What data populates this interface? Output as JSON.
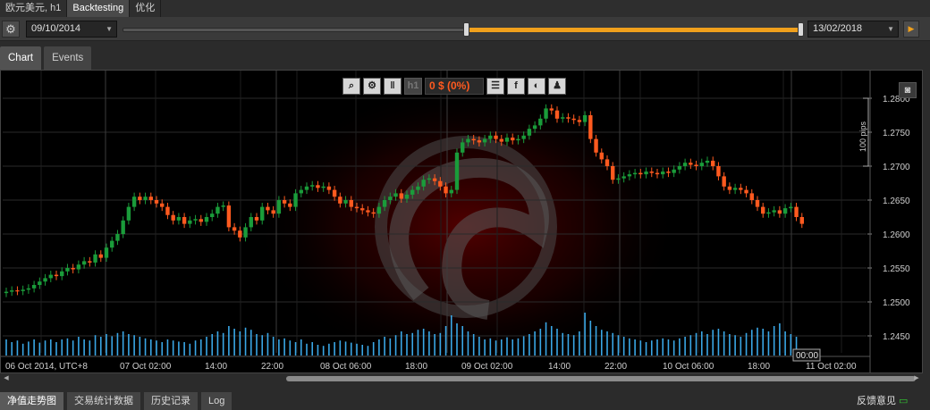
{
  "top_tabs": [
    {
      "label": "欧元美元, h1"
    },
    {
      "label": "Backtesting"
    },
    {
      "label": "优化"
    }
  ],
  "toolbar": {
    "start_date": "09/10/2014",
    "end_date": "13/02/2018",
    "range_start_fraction": 0.504,
    "range_end_fraction": 1.0
  },
  "chart_tabs": [
    {
      "label": "Chart"
    },
    {
      "label": "Events"
    }
  ],
  "chart_toolbar": {
    "pnl_text": "0 $ (0%)",
    "timeframe_label": "h1"
  },
  "bottom_tabs": [
    {
      "label": "净值走势图"
    },
    {
      "label": "交易统计数据"
    },
    {
      "label": "历史记录"
    },
    {
      "label": "Log"
    }
  ],
  "feedback_label": "反馈意见",
  "colors": {
    "bull": "#1a9c3a",
    "bear": "#ff5a1f",
    "volume": "#3aa7e6",
    "accent": "#f0a01c"
  },
  "chart_data": {
    "type": "candlestick",
    "symbol": "欧元美元",
    "timeframe": "h1",
    "y_ticks": [
      "1.2800",
      "1.2750",
      "1.2700",
      "1.2650",
      "1.2600",
      "1.2550",
      "1.2500",
      "1.2450"
    ],
    "ylim": [
      1.2425,
      1.2825
    ],
    "x_ticks": [
      "06 Oct 2014, UTC+8",
      "07 Oct 02:00",
      "14:00",
      "22:00",
      "08 Oct 06:00",
      "18:00",
      "09 Oct 02:00",
      "14:00",
      "22:00",
      "10 Oct 06:00",
      "18:00",
      "11 Oct 02:00"
    ],
    "scale_label": "100 pips",
    "cursor_time_label": "00:00",
    "closes": [
      1.2515,
      1.2517,
      1.2516,
      1.2518,
      1.252,
      1.2525,
      1.253,
      1.2535,
      1.254,
      1.2538,
      1.2545,
      1.255,
      1.2548,
      1.2555,
      1.256,
      1.2558,
      1.257,
      1.2565,
      1.258,
      1.259,
      1.26,
      1.262,
      1.264,
      1.2655,
      1.265,
      1.2655,
      1.265,
      1.2645,
      1.264,
      1.2628,
      1.262,
      1.2625,
      1.2615,
      1.262,
      1.2622,
      1.2618,
      1.2625,
      1.263,
      1.264,
      1.2642,
      1.261,
      1.2605,
      1.2595,
      1.261,
      1.2625,
      1.262,
      1.264,
      1.2635,
      1.263,
      1.265,
      1.2645,
      1.264,
      1.266,
      1.2665,
      1.267,
      1.2672,
      1.2668,
      1.267,
      1.2665,
      1.2655,
      1.2645,
      1.265,
      1.264,
      1.2638,
      1.2635,
      1.2632,
      1.263,
      1.264,
      1.265,
      1.2655,
      1.266,
      1.2652,
      1.2658,
      1.2665,
      1.267,
      1.268,
      1.2682,
      1.2678,
      1.267,
      1.266,
      1.2665,
      1.272,
      1.2735,
      1.274,
      1.2738,
      1.2735,
      1.274,
      1.2745,
      1.274,
      1.2736,
      1.2742,
      1.2738,
      1.274,
      1.2745,
      1.2755,
      1.276,
      1.277,
      1.2785,
      1.2782,
      1.277,
      1.2772,
      1.277,
      1.2768,
      1.2765,
      1.2775,
      1.274,
      1.272,
      1.271,
      1.27,
      1.268,
      1.2682,
      1.2685,
      1.2688,
      1.269,
      1.2688,
      1.2692,
      1.269,
      1.2688,
      1.2692,
      1.269,
      1.2695,
      1.27,
      1.2705,
      1.2702,
      1.27,
      1.2705,
      1.2708,
      1.27,
      1.2685,
      1.267,
      1.2665,
      1.2668,
      1.2665,
      1.266,
      1.265,
      1.264,
      1.263,
      1.2632,
      1.2635,
      1.263,
      1.2638,
      1.264,
      1.2625,
      1.2615
    ],
    "volumes": [
      0.3,
      0.25,
      0.28,
      0.22,
      0.26,
      0.3,
      0.24,
      0.28,
      0.3,
      0.25,
      0.3,
      0.32,
      0.28,
      0.35,
      0.3,
      0.28,
      0.38,
      0.35,
      0.4,
      0.36,
      0.42,
      0.45,
      0.4,
      0.38,
      0.35,
      0.32,
      0.3,
      0.28,
      0.25,
      0.3,
      0.28,
      0.26,
      0.25,
      0.22,
      0.28,
      0.3,
      0.35,
      0.4,
      0.45,
      0.42,
      0.55,
      0.5,
      0.45,
      0.52,
      0.48,
      0.4,
      0.38,
      0.42,
      0.35,
      0.3,
      0.32,
      0.28,
      0.25,
      0.3,
      0.22,
      0.25,
      0.2,
      0.18,
      0.22,
      0.25,
      0.28,
      0.26,
      0.24,
      0.22,
      0.2,
      0.18,
      0.25,
      0.3,
      0.35,
      0.32,
      0.38,
      0.45,
      0.4,
      0.42,
      0.48,
      0.5,
      0.45,
      0.4,
      0.42,
      0.55,
      0.75,
      0.6,
      0.55,
      0.45,
      0.4,
      0.35,
      0.3,
      0.32,
      0.28,
      0.3,
      0.34,
      0.3,
      0.32,
      0.36,
      0.4,
      0.45,
      0.5,
      0.62,
      0.55,
      0.5,
      0.42,
      0.4,
      0.38,
      0.45,
      0.8,
      0.65,
      0.55,
      0.48,
      0.45,
      0.42,
      0.38,
      0.35,
      0.32,
      0.3,
      0.28,
      0.25,
      0.28,
      0.3,
      0.32,
      0.3,
      0.28,
      0.32,
      0.35,
      0.38,
      0.42,
      0.45,
      0.4,
      0.48,
      0.5,
      0.45,
      0.4,
      0.38,
      0.35,
      0.42,
      0.48,
      0.52,
      0.5,
      0.45,
      0.55,
      0.6,
      0.45,
      0.4,
      0.35
    ],
    "volume_max_label": ""
  }
}
